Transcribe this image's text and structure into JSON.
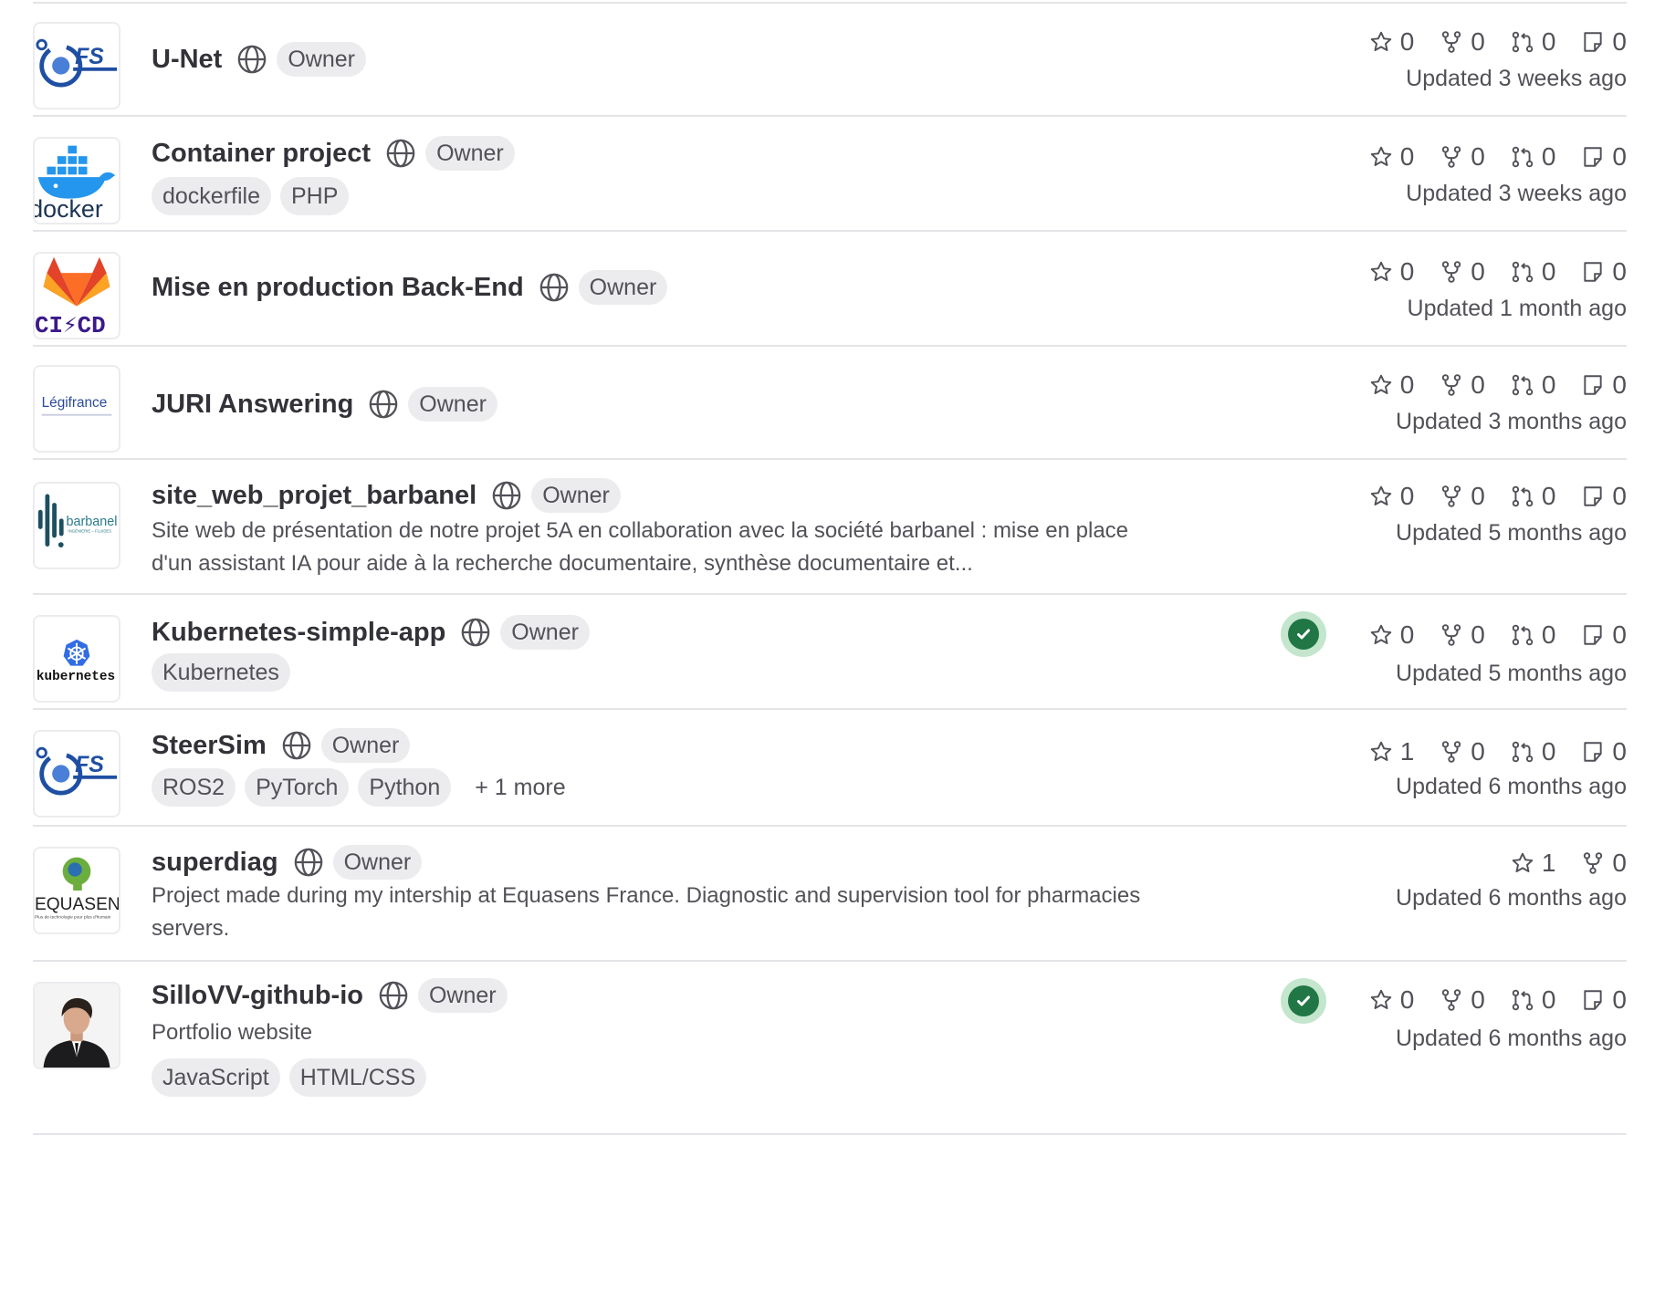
{
  "projects": [
    {
      "name": "U-Net",
      "badge": "Owner",
      "avatar_icon": "fs-faculty-logo",
      "topics": [],
      "stats": {
        "stars": "0",
        "forks": "0",
        "merge_requests": "0",
        "issues": "0"
      },
      "updated": "Updated 3 weeks ago"
    },
    {
      "name": "Container project",
      "badge": "Owner",
      "avatar_icon": "docker-logo",
      "topics": [
        "dockerfile",
        "PHP"
      ],
      "stats": {
        "stars": "0",
        "forks": "0",
        "merge_requests": "0",
        "issues": "0"
      },
      "updated": "Updated 3 weeks ago"
    },
    {
      "name": "Mise en production Back-End",
      "badge": "Owner",
      "avatar_icon": "gitlab-cicd-logo",
      "topics": [],
      "stats": {
        "stars": "0",
        "forks": "0",
        "merge_requests": "0",
        "issues": "0"
      },
      "updated": "Updated 1 month ago"
    },
    {
      "name": "JURI Answering",
      "badge": "Owner",
      "avatar_icon": "legifrance-logo",
      "topics": [],
      "stats": {
        "stars": "0",
        "forks": "0",
        "merge_requests": "0",
        "issues": "0"
      },
      "updated": "Updated 3 months ago"
    },
    {
      "name": "site_web_projet_barbanel",
      "badge": "Owner",
      "avatar_icon": "barbanel-logo",
      "description": "Site web de présentation de notre projet 5A en collaboration avec la société barbanel : mise en place d'un assistant IA pour aide à la recherche documentaire, synthèse documentaire et...",
      "topics": [],
      "stats": {
        "stars": "0",
        "forks": "0",
        "merge_requests": "0",
        "issues": "0"
      },
      "updated": "Updated 5 months ago"
    },
    {
      "name": "Kubernetes-simple-app",
      "badge": "Owner",
      "avatar_icon": "kubernetes-logo",
      "topics": [
        "Kubernetes"
      ],
      "pipeline": "passed",
      "stats": {
        "stars": "0",
        "forks": "0",
        "merge_requests": "0",
        "issues": "0"
      },
      "updated": "Updated 5 months ago"
    },
    {
      "name": "SteerSim",
      "badge": "Owner",
      "avatar_icon": "fs-faculty-logo",
      "topics": [
        "ROS2",
        "PyTorch",
        "Python"
      ],
      "more_topics": "+ 1 more",
      "stats": {
        "stars": "1",
        "forks": "0",
        "merge_requests": "0",
        "issues": "0"
      },
      "updated": "Updated 6 months ago"
    },
    {
      "name": "superdiag",
      "badge": "Owner",
      "avatar_icon": "equasens-logo",
      "description": "Project made during my intership at Equasens France. Diagnostic and supervision tool for pharmacies servers.",
      "topics": [],
      "stats": {
        "stars": "1",
        "forks": "0"
      },
      "updated": "Updated 6 months ago"
    },
    {
      "name": "SilloVV-github-io",
      "badge": "Owner",
      "avatar_icon": "user-photo-avatar",
      "description": "Portfolio website",
      "topics": [
        "JavaScript",
        "HTML/CSS"
      ],
      "pipeline": "passed",
      "stats": {
        "stars": "0",
        "forks": "0",
        "merge_requests": "0",
        "issues": "0"
      },
      "updated": "Updated 6 months ago"
    }
  ],
  "avatar_text": {
    "fs": "FS",
    "docker": "docker",
    "cicd": "CI⚡CD",
    "legifrance": "Légifrance",
    "barbanel": "barbanel",
    "barbanel_sub": "INGÉNIERIE – FLUIDES",
    "kubernetes": "kubernetes",
    "equasens": "EQUASENS",
    "equasens_sub": "Plus de technologie pour plus d'humain"
  },
  "colors": {
    "text": "#333238",
    "muted": "#535158",
    "badge_bg": "#ececef",
    "border": "#e4e4e8",
    "pipeline_success": "#217645",
    "pipeline_ring": "#c3e6cd",
    "fs_blue": "#1f4fa3",
    "docker_blue": "#2496ed",
    "gitlab_orange": "#fc6d26",
    "cicd_purple": "#3b1a8a",
    "legifrance_blue": "#2a4a9a",
    "barbanel_teal": "#1d4f5f",
    "kubernetes_blue": "#326ce5",
    "equasens_green": "#6cae3e"
  }
}
